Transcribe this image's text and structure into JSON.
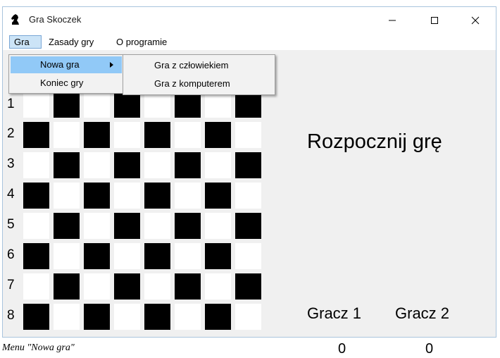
{
  "window": {
    "title": "Gra Skoczek",
    "icon": "chess-knight-icon"
  },
  "menubar": {
    "items": [
      "Gra",
      "Zasady gry",
      "O programie"
    ]
  },
  "dropdown": {
    "items": [
      "Nowa gra",
      "Koniec gry"
    ]
  },
  "submenu": {
    "items": [
      "Gra z człowiekiem",
      "Gra z komputerem"
    ]
  },
  "board": {
    "rows": [
      "1",
      "2",
      "3",
      "4",
      "5",
      "6",
      "7",
      "8"
    ],
    "size": 8,
    "dark_color": "#000000",
    "light_color": "#ffffff"
  },
  "game": {
    "status": "Rozpocznij grę",
    "player1": {
      "label": "Gracz 1",
      "score": "0"
    },
    "player2": {
      "label": "Gracz 2",
      "score": "0"
    }
  },
  "caption": "Menu \"Nowa gra\""
}
